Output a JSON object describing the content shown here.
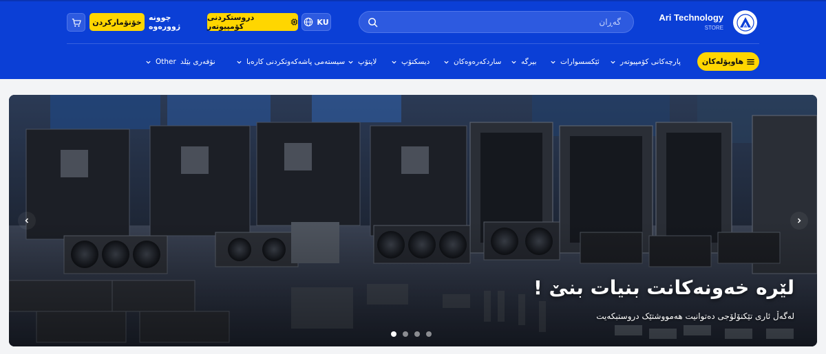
{
  "header": {
    "logo": {
      "title": "Ari Technology",
      "subtitle": "STORE"
    },
    "search": {
      "placeholder": "گەڕان"
    },
    "language": {
      "label": "KU"
    },
    "build_pc": {
      "label": "دروستکردنی کۆمپیوتەر"
    },
    "login": {
      "label": "چوونە ژوورەوە"
    },
    "register": {
      "label": "خۆتۆمارکردن"
    }
  },
  "nav": {
    "categories": {
      "label": "هاوپۆلەکان"
    },
    "items": [
      {
        "label": "پارچەکانی کۆمپیوتەر"
      },
      {
        "label": "ئێکسسوارات"
      },
      {
        "label": "بیرگە"
      },
      {
        "label": "ساردکەرەوەکان"
      },
      {
        "label": "دیسکتۆپ"
      },
      {
        "label": "لاپتۆپ"
      },
      {
        "label": "سیستەمی پاشەکەوتکردنی کارەبا"
      },
      {
        "label": "نۆفەری بێلد"
      },
      {
        "label": "Other"
      }
    ]
  },
  "hero": {
    "title": "لێرە خەونەکانت بنیات بنێ !",
    "subtitle": "لەگەڵ ئاری تێکنۆلۆجی دەتوانیت هەمووشتێک دروستبکەیت",
    "slides_total": 4,
    "active_slide": 1
  },
  "colors": {
    "primary": "#0b3fd6",
    "accent": "#ffd600"
  }
}
